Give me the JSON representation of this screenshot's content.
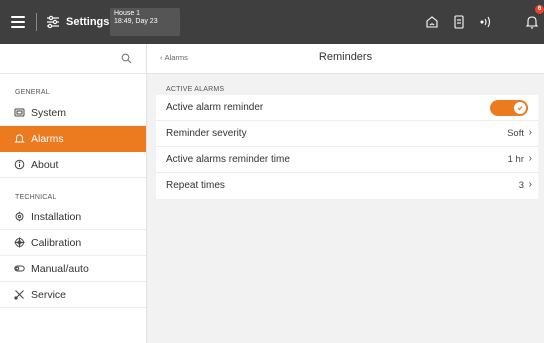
{
  "topbar": {
    "settings_label": "Settings",
    "house_name": "House 1",
    "house_time": "18:49, Day 23",
    "notification_count": "6"
  },
  "sidebar": {
    "general_heading": "GENERAL",
    "technical_heading": "TECHNICAL",
    "items": [
      {
        "label": "System"
      },
      {
        "label": "Alarms"
      },
      {
        "label": "About"
      },
      {
        "label": "Installation"
      },
      {
        "label": "Calibration"
      },
      {
        "label": "Manual/auto"
      },
      {
        "label": "Service"
      }
    ]
  },
  "main": {
    "back_label": "Alarms",
    "title": "Reminders",
    "section_label": "ACTIVE ALARMS",
    "rows": [
      {
        "label": "Active alarm reminder",
        "value": ""
      },
      {
        "label": "Reminder severity",
        "value": "Soft"
      },
      {
        "label": "Active alarms reminder time",
        "value": "1 hr"
      },
      {
        "label": "Repeat times",
        "value": "3"
      }
    ],
    "toggle_on": true
  },
  "colors": {
    "accent": "#ec7a1f",
    "topbar": "#3f3f3f",
    "badge": "#e8432b"
  }
}
